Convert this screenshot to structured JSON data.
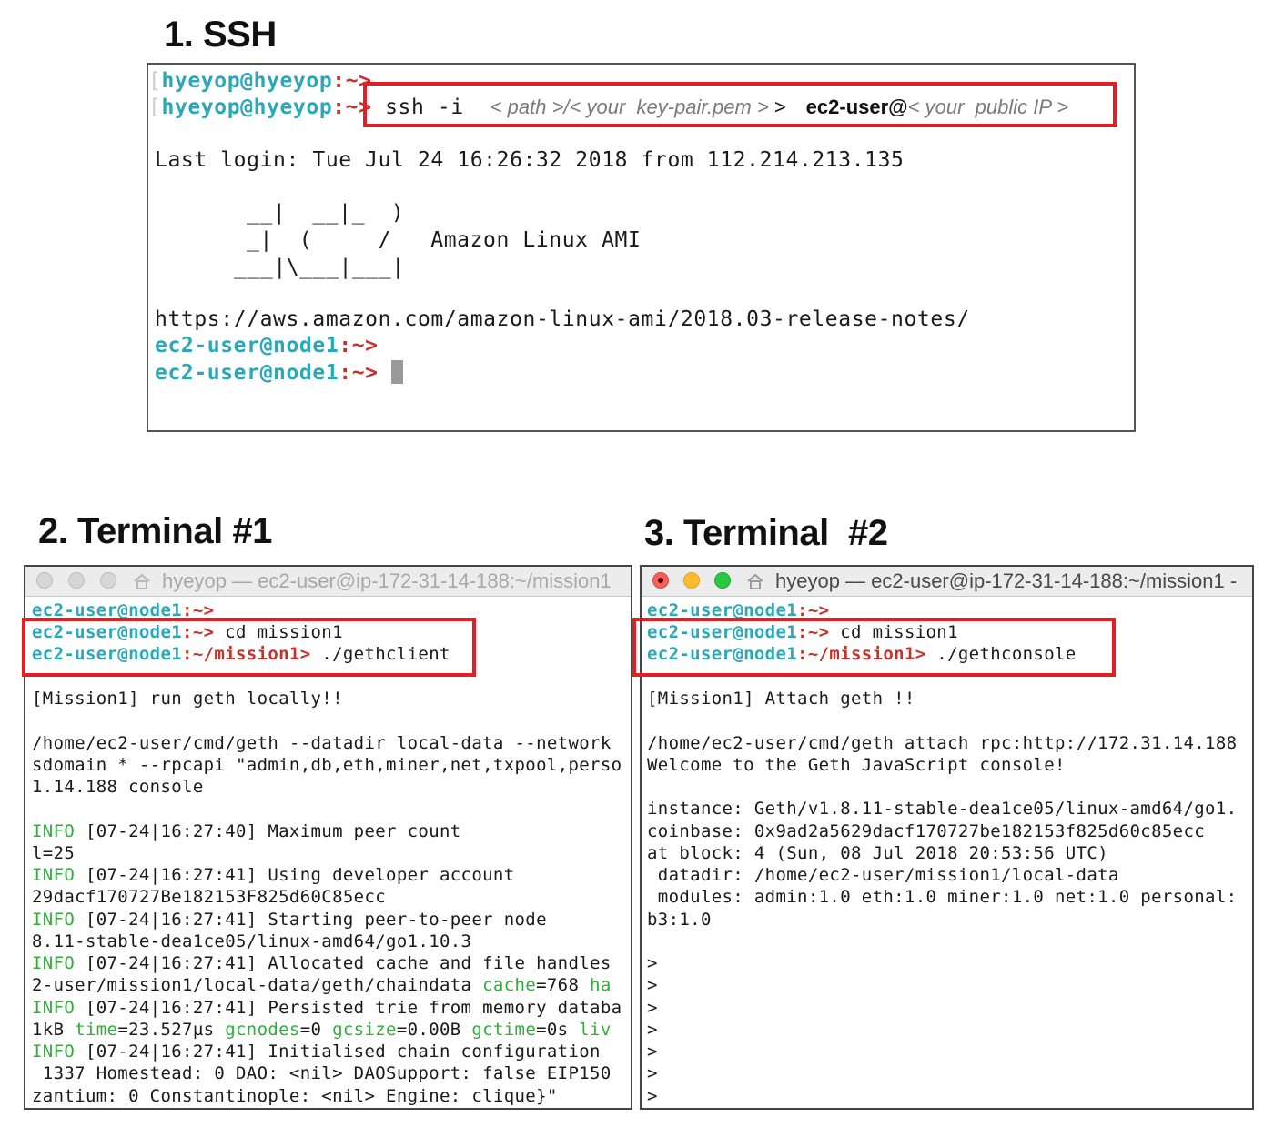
{
  "sections": {
    "ssh": "1. SSH",
    "term1": "2. Terminal #1",
    "term2": "3. Terminal  #2"
  },
  "ssh_terminal": {
    "prompt_user": "hyeyop@hyeyop",
    "prompt_sep": ":~>",
    "cmd_ssh": "ssh -i",
    "ph_path": "< path >/< your  key-pair.pem >",
    "gt": ">",
    "ec2_user_at": "ec2-user@",
    "ph_ip": "< your  public IP >",
    "last_login": "Last login: Tue Jul 24 16:26:32 2018 from 112.214.213.135",
    "ascii_1": "__|  __|_  )",
    "ascii_2": "_|  (     /   Amazon Linux AMI",
    "ascii_3": "___|\\___|___|",
    "release_url": "https://aws.amazon.com/amazon-linux-ami/2018.03-release-notes/",
    "prompt2_user": "ec2-user@node1",
    "prompt2_sep": ":~>"
  },
  "term1": {
    "title": "hyeyop — ec2-user@ip-172-31-14-188:~/mission1",
    "p_user": "ec2-user@node1",
    "p_home": ":~>",
    "p_mission": ":~/mission1>",
    "cmd_cd": " cd mission1",
    "cmd_run": " ./gethclient",
    "msg": "[Mission1] run geth locally!!",
    "geth_cmd_1": "/home/ec2-user/cmd/geth --datadir local-data --network",
    "geth_cmd_2": "sdomain * --rpcapi \"admin,db,eth,miner,net,txpool,perso",
    "geth_cmd_3": "1.14.188 console",
    "info": "INFO",
    "log_1": " [07-24|16:27:40] Maximum peer count",
    "log_1b": "l=25",
    "log_2": " [07-24|16:27:41] Using developer account",
    "log_2b": "29dacf170727Be182153F825d60C85ecc",
    "log_3": " [07-24|16:27:41] Starting peer-to-peer node",
    "log_3b": "8.11-stable-dea1ce05/linux-amd64/go1.10.3",
    "log_4": " [07-24|16:27:41] Allocated cache and file handles",
    "log_4b": "2-user/mission1/local-data/geth/chaindata ",
    "k_cache": "cache",
    "v_cache": "=768 ",
    "k_ha": "ha",
    "log_5": " [07-24|16:27:41] Persisted trie from memory databa",
    "log_5b": "1kB ",
    "k_time": "time",
    "v_time": "=23.527µs ",
    "k_gcnodes": "gcnodes",
    "v_gcnodes": "=0 ",
    "k_gcsize": "gcsize",
    "v_gcsize": "=0.00B ",
    "k_gctime": "gctime",
    "v_gctime": "=0s ",
    "k_liv": "liv",
    "log_6": " [07-24|16:27:41] Initialised chain configuration",
    "log_6b": " 1337 Homestead: 0 DAO: <nil> DAOSupport: false EIP150",
    "log_6c": "zantium: 0 Constantinople: <nil> Engine: clique}\""
  },
  "term2": {
    "title": "hyeyop — ec2-user@ip-172-31-14-188:~/mission1 -",
    "p_user": "ec2-user@node1",
    "p_home": ":~>",
    "p_mission": ":~/mission1>",
    "cmd_cd": " cd mission1",
    "cmd_run": " ./gethconsole",
    "msg": "[Mission1] Attach geth !!",
    "attach_cmd": "/home/ec2-user/cmd/geth attach rpc:http://172.31.14.188",
    "welcome": "Welcome to the Geth JavaScript console!",
    "instance": "instance: Geth/v1.8.11-stable-dea1ce05/linux-amd64/go1.",
    "coinbase": "coinbase: 0x9ad2a5629dacf170727be182153f825d60c85ecc",
    "at_block": "at block: 4 (Sun, 08 Jul 2018 20:53:56 UTC)",
    "datadir": " datadir: /home/ec2-user/mission1/local-data",
    "modules": " modules: admin:1.0 eth:1.0 miner:1.0 net:1.0 personal:",
    "modules_b": "b3:1.0",
    "prompt": ">"
  },
  "colors": {
    "prompt_user": "#2aa8b8",
    "prompt_node": "#2fae3a",
    "prompt_path": "#c8302c",
    "highlight_box": "#e41e25"
  }
}
